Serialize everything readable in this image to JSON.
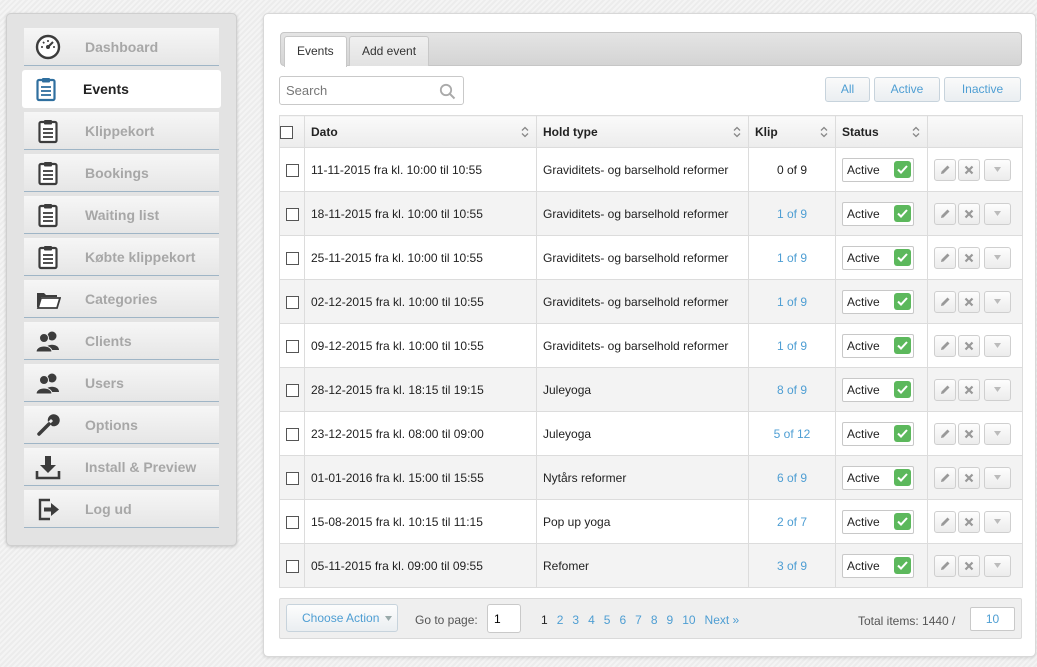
{
  "sidebar": {
    "items": [
      {
        "label": "Dashboard",
        "icon": "dashboard-icon",
        "active": false
      },
      {
        "label": "Events",
        "icon": "clipboard-icon",
        "active": true
      },
      {
        "label": "Klippekort",
        "icon": "clipboard-icon",
        "active": false
      },
      {
        "label": "Bookings",
        "icon": "clipboard-icon",
        "active": false
      },
      {
        "label": "Waiting list",
        "icon": "clipboard-icon",
        "active": false
      },
      {
        "label": "Købte klippekort",
        "icon": "clipboard-icon",
        "active": false
      },
      {
        "label": "Categories",
        "icon": "folder-icon",
        "active": false
      },
      {
        "label": "Clients",
        "icon": "users-icon",
        "active": false
      },
      {
        "label": "Users",
        "icon": "users-icon",
        "active": false
      },
      {
        "label": "Options",
        "icon": "wrench-icon",
        "active": false
      },
      {
        "label": "Install & Preview",
        "icon": "download-icon",
        "active": false
      },
      {
        "label": "Log ud",
        "icon": "logout-icon",
        "active": false
      }
    ]
  },
  "tabs": [
    {
      "label": "Events",
      "active": true
    },
    {
      "label": "Add event",
      "active": false
    }
  ],
  "search": {
    "placeholder": "Search",
    "value": ""
  },
  "filters": {
    "all": "All",
    "active": "Active",
    "inactive": "Inactive"
  },
  "table": {
    "columns": {
      "date": "Dato",
      "type": "Hold type",
      "klip": "Klip",
      "status": "Status"
    },
    "rows": [
      {
        "date": "11-11-2015 fra kl. 10:00 til 10:55",
        "type": "Graviditets- og barselhold reformer",
        "klip": "0 of 9",
        "klip_link": false,
        "status": "Active"
      },
      {
        "date": "18-11-2015 fra kl. 10:00 til 10:55",
        "type": "Graviditets- og barselhold reformer",
        "klip": "1 of 9",
        "klip_link": true,
        "status": "Active"
      },
      {
        "date": "25-11-2015 fra kl. 10:00 til 10:55",
        "type": "Graviditets- og barselhold reformer",
        "klip": "1 of 9",
        "klip_link": true,
        "status": "Active"
      },
      {
        "date": "02-12-2015 fra kl. 10:00 til 10:55",
        "type": "Graviditets- og barselhold reformer",
        "klip": "1 of 9",
        "klip_link": true,
        "status": "Active"
      },
      {
        "date": "09-12-2015 fra kl. 10:00 til 10:55",
        "type": "Graviditets- og barselhold reformer",
        "klip": "1 of 9",
        "klip_link": true,
        "status": "Active"
      },
      {
        "date": "28-12-2015 fra kl. 18:15 til 19:15",
        "type": "Juleyoga",
        "klip": "8 of 9",
        "klip_link": true,
        "status": "Active"
      },
      {
        "date": "23-12-2015 fra kl. 08:00 til 09:00",
        "type": "Juleyoga",
        "klip": "5 of 12",
        "klip_link": true,
        "status": "Active"
      },
      {
        "date": "01-01-2016 fra kl. 15:00 til 15:55",
        "type": "Nytårs reformer",
        "klip": "6 of 9",
        "klip_link": true,
        "status": "Active"
      },
      {
        "date": "15-08-2015 fra kl. 10:15 til 11:15",
        "type": "Pop up yoga",
        "klip": "2 of 7",
        "klip_link": true,
        "status": "Active"
      },
      {
        "date": "05-11-2015 fra kl. 09:00 til 09:55",
        "type": "Refomer",
        "klip": "3 of 9",
        "klip_link": true,
        "status": "Active"
      }
    ]
  },
  "footer": {
    "choose_action": "Choose Action",
    "goto_label": "Go to page:",
    "goto_value": "1",
    "pages": [
      "1",
      "2",
      "3",
      "4",
      "5",
      "6",
      "7",
      "8",
      "9",
      "10"
    ],
    "current_page": "1",
    "next_label": "Next »",
    "total_label": "Total items: 1440 /",
    "per_page": "10"
  },
  "colors": {
    "link": "#4e9ed3",
    "status_green": "#5cb85c",
    "icon_dark": "#3c3c3c",
    "icon_active": "#2f6f9f"
  }
}
